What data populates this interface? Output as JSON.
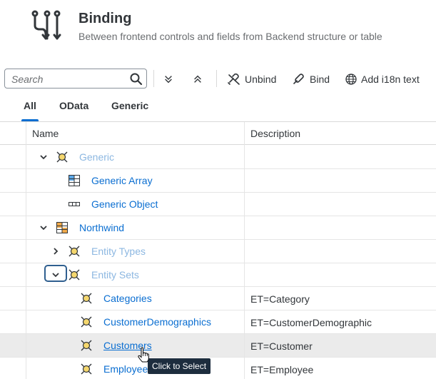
{
  "header": {
    "title": "Binding",
    "subtitle": "Between frontend controls and fields from Backend structure or table",
    "icon": "binding-icon"
  },
  "toolbar": {
    "search_placeholder": "Search",
    "collapse_icon": "collapse-all-icon",
    "expand_icon": "expand-all-icon",
    "unbind_label": "Unbind",
    "bind_label": "Bind",
    "i18n_label": "Add i18n text"
  },
  "tabs": [
    {
      "label": "All",
      "active": true
    },
    {
      "label": "OData",
      "active": false
    },
    {
      "label": "Generic",
      "active": false
    }
  ],
  "table": {
    "columns": [
      "Name",
      "Description"
    ],
    "rows": [
      {
        "name": "Generic",
        "description": "",
        "expanded": true,
        "icon": "entity-icon",
        "style": "disabled"
      },
      {
        "name": "Generic Array",
        "description": "",
        "icon": "array-icon",
        "style": "link"
      },
      {
        "name": "Generic Object",
        "description": "",
        "icon": "object-icon",
        "style": "link"
      },
      {
        "name": "Northwind",
        "description": "",
        "expanded": true,
        "icon": "datasource-icon",
        "style": "link"
      },
      {
        "name": "Entity Types",
        "description": "",
        "expanded": false,
        "icon": "entity-icon",
        "style": "disabled"
      },
      {
        "name": "Entity Sets",
        "description": "",
        "expanded": true,
        "icon": "entity-icon",
        "style": "disabled"
      },
      {
        "name": "Categories",
        "description": "ET=Category",
        "icon": "entity-icon",
        "style": "link"
      },
      {
        "name": "CustomerDemographics",
        "description": "ET=CustomerDemographic",
        "icon": "entity-icon",
        "style": "link"
      },
      {
        "name": "Customers",
        "description": "ET=Customer",
        "icon": "entity-icon",
        "style": "link-hover",
        "selected": true
      },
      {
        "name": "Employees",
        "description": "ET=Employee",
        "icon": "entity-icon",
        "style": "link"
      }
    ]
  },
  "tooltip": "Click to Select",
  "colors": {
    "link": "#0a6ed1",
    "link_disabled": "#8cb7e1",
    "accent": "#0a6ed1",
    "selected_row": "#ebebeb",
    "entity_icon_fill": "#f5d76e"
  }
}
